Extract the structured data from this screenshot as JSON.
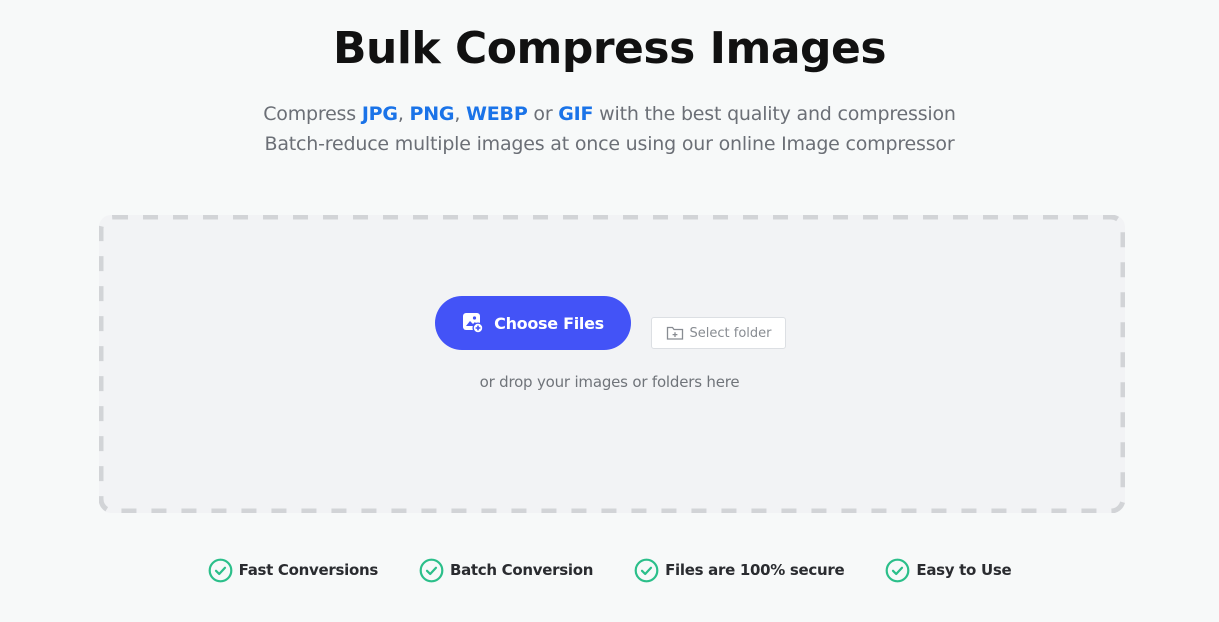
{
  "header": {
    "title": "Bulk Compress Images",
    "subtitle": {
      "line1_prefix": "Compress ",
      "formats": [
        "JPG",
        "PNG",
        "WEBP",
        "GIF"
      ],
      "sep1": ", ",
      "sep2": ", ",
      "sep3": " or ",
      "line1_suffix": " with the best quality and compression",
      "line2": "Batch-reduce multiple images at once using our online Image compressor"
    }
  },
  "upload": {
    "choose_files_label": "Choose Files",
    "choose_files_icon": "image-add-icon",
    "select_folder_label": "Select folder",
    "select_folder_icon": "folder-add-icon",
    "drop_hint": "or drop your images or folders here"
  },
  "features": [
    {
      "label": "Fast Conversions",
      "icon": "check-circle-icon"
    },
    {
      "label": "Batch Conversion",
      "icon": "check-circle-icon"
    },
    {
      "label": "Files are 100% secure",
      "icon": "check-circle-icon"
    },
    {
      "label": "Easy to Use",
      "icon": "check-circle-icon"
    }
  ],
  "colors": {
    "primary": "#4353f7",
    "format_link": "#1a73e8",
    "check": "#2bbf8a",
    "dropzone_bg": "#f2f3f5",
    "dash": "#d2d4d7"
  }
}
